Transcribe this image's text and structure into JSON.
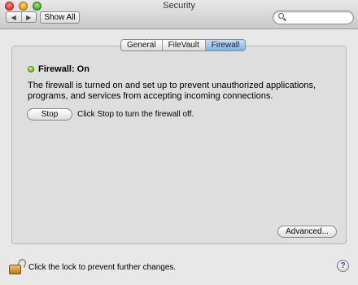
{
  "window": {
    "title": "Security"
  },
  "toolbar": {
    "back_glyph": "◀",
    "forward_glyph": "▶",
    "show_all_label": "Show All",
    "search_placeholder": "",
    "search_value": ""
  },
  "tabs": [
    {
      "label": "General"
    },
    {
      "label": "FileVault"
    },
    {
      "label": "Firewall",
      "active": true
    }
  ],
  "firewall": {
    "status": "Firewall: On",
    "status_color": "#67b20b",
    "description": "The firewall is turned on and set up to prevent unauthorized applications, programs, and services from accepting incoming connections.",
    "stop_label": "Stop",
    "stop_hint": "Click Stop to turn the firewall off.",
    "advanced_label": "Advanced..."
  },
  "footer": {
    "lock_text": "Click the lock to prevent further changes.",
    "help_glyph": "?",
    "lock_icon": "lock-open-icon"
  }
}
